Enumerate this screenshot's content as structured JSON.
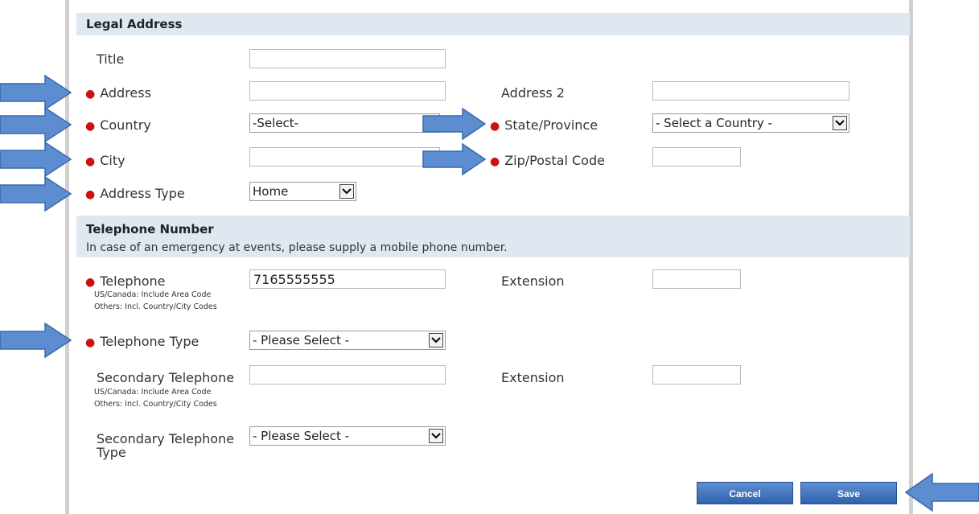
{
  "legal_address": {
    "header": "Legal Address",
    "title_label": "Title",
    "title_value": "",
    "address_label": "Address",
    "address_value": "",
    "address2_label": "Address 2",
    "address2_value": "",
    "country_label": "Country",
    "country_value": "-Select-",
    "state_label": "State/Province",
    "state_value": "- Select a Country -",
    "city_label": "City",
    "city_value": "",
    "zip_label": "Zip/Postal Code",
    "zip_value": "",
    "address_type_label": "Address Type",
    "address_type_value": "Home"
  },
  "telephone": {
    "header": "Telephone Number",
    "subheader": "In case of an emergency at events, please supply a mobile phone number.",
    "phone_label": "Telephone",
    "phone_hint_1": "US/Canada: Include Area Code",
    "phone_hint_2": "Others: Incl. Country/City Codes",
    "phone_value": "7165555555",
    "extension_label": "Extension",
    "extension_value": "",
    "phone_type_label": "Telephone Type",
    "phone_type_value": "- Please Select -",
    "secondary_label": "Secondary Telephone",
    "secondary_hint_1": "US/Canada: Include Area Code",
    "secondary_hint_2": "Others: Incl. Country/City Codes",
    "secondary_value": "",
    "secondary_extension_label": "Extension",
    "secondary_extension_value": "",
    "secondary_type_label": "Secondary Telephone Type",
    "secondary_type_value": "- Please Select -"
  },
  "actions": {
    "cancel_label": "Cancel",
    "save_label": "Save"
  },
  "colors": {
    "header_bg": "#dfe7f1",
    "required_marker": "#cc1111",
    "button_blue": "#3a6fbf",
    "annotation_arrow": "#5b8dd0"
  },
  "icons": {
    "required": "red-dot-icon",
    "dropdown": "chevron-down-icon",
    "annotation": "arrow-right-icon",
    "annotation_save": "arrow-left-icon"
  }
}
